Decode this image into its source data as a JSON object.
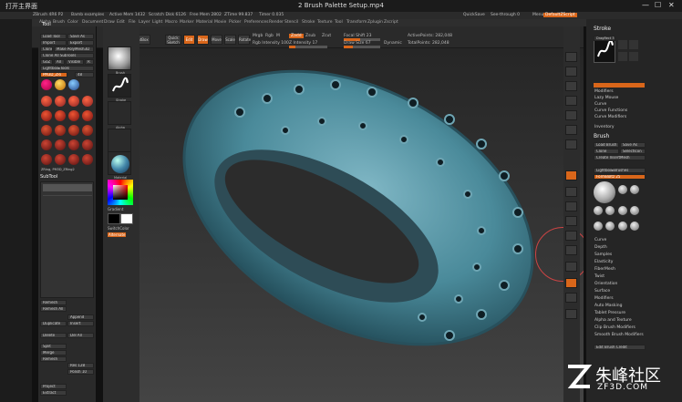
{
  "titlebar": {
    "back": "打开主界面",
    "title": "2 Brush Palette Setup.mp4",
    "min": "—",
    "max": "☐",
    "close": "✕"
  },
  "zbar": [
    "ZBrush 4R6 P2",
    "Bamb examples",
    "Active Mem 1432",
    "Scratch Disk 6126",
    "Free Mem 2802",
    "ZTime 99.837",
    "Timer 0.035",
    "QuickSave",
    "See-through 0",
    "Menus",
    "DefaultZScript"
  ],
  "menu": [
    "Alpha",
    "Brush",
    "Color",
    "Document",
    "Draw",
    "Edit",
    "File",
    "Layer",
    "Light",
    "Macro",
    "Marker",
    "Material",
    "Movie",
    "Picker",
    "Preferences",
    "Render",
    "Stencil",
    "Stroke",
    "Texture",
    "Tool",
    "Transform",
    "Zplugin",
    "Zscript"
  ],
  "toolbar": {
    "current_brush": "Current Brush",
    "projection_master": "Projection Master",
    "lightbox": "LightBox",
    "quick_sketch": "Quick Sketch",
    "edit": "Edit",
    "draw": "Draw",
    "move": "Move",
    "scale": "Scale",
    "rotate": "Rotate",
    "mrgb": "Mrgb",
    "rgb": "Rgb",
    "m": "M",
    "rgb_intensity": "Rgb Intensity 100",
    "zadd": "Zadd",
    "zsub": "Zsub",
    "zcut": "Zcut",
    "z_intensity": "Z Intensity 17",
    "focal_shift": "Focal Shift 23",
    "draw_size": "Draw Size 67",
    "dynamic": "Dynamic",
    "active_points": "ActivePoints: 282,048",
    "total_points": "TotalPoints: 282,048"
  },
  "left_panel": {
    "tool": "Tool",
    "load_tool": "Load Tool",
    "save_as": "Save As",
    "import": "Import",
    "export": "Export",
    "clone": "Clone",
    "make_polymesh": "Make PolyMesh3D",
    "clone_all": "Clone All SubTools",
    "goz": "GoZ",
    "all": "All",
    "visible": "Visible",
    "r": "R",
    "lightbox_tools": "Lightbox▸Tools",
    "brush_name": "PM3D_ZRi",
    "brush_size": "48",
    "subtool": "SubTool",
    "remesh": "Remesh",
    "remesh_all": "Remesh All",
    "duplicate": "Duplicate",
    "append": "Append",
    "insert": "Insert",
    "delete": "Delete",
    "del_all": "Del All",
    "split": "Split",
    "merge": "Merge",
    "remesh2": "Remesh",
    "res": "Res 128",
    "project": "Project",
    "extract": "Extract",
    "polish": "Polish 10",
    "thumbs_label": "ZRing, PM3D_ZRing2"
  },
  "shelf": {
    "brush": "Brush",
    "stroke": "Stroke",
    "alpha": "Alpha",
    "texture": "Texture",
    "material": "Material",
    "gradient": "Gradient",
    "switch_color": "SwitchColor",
    "alternate": "Alternate"
  },
  "right_panel": {
    "stroke": "Stroke",
    "dragrect": "DragRect 3",
    "modifiers": "Modifiers",
    "lazy_mouse": "Lazy Mouse",
    "curve": "Curve",
    "curve_functions": "Curve Functions",
    "curve_modifiers": "Curve Modifiers",
    "inventory": "Inventory",
    "brush": "Brush",
    "load_brush": "Load Brush",
    "save_as": "Save As",
    "clone": "Clone",
    "select_icon": "SelectIcon",
    "create_insert_mesh": "Create InsertMesh",
    "lightbox_brushes": "Lightbox▸Brushes",
    "formboltz": "FormBoltz 25",
    "list": [
      "Curve",
      "Depth",
      "Samples",
      "Elasticity",
      "FiberMesh",
      "Twist",
      "Orientation",
      "Surface",
      "Modifiers",
      "Auto Masking",
      "Tablet Pressure",
      "Alpha and Texture",
      "Clip Brush Modifiers",
      "Smooth Brush Modifiers"
    ],
    "edit_brush_credit": "Edit Brush Credit"
  },
  "watermark": {
    "brand": "朱峰社区",
    "url": "ZF3D.COM"
  },
  "colors": {
    "accent": "#d9661a",
    "ring": "#4a8a9a",
    "panel": "#2a2a2a"
  }
}
